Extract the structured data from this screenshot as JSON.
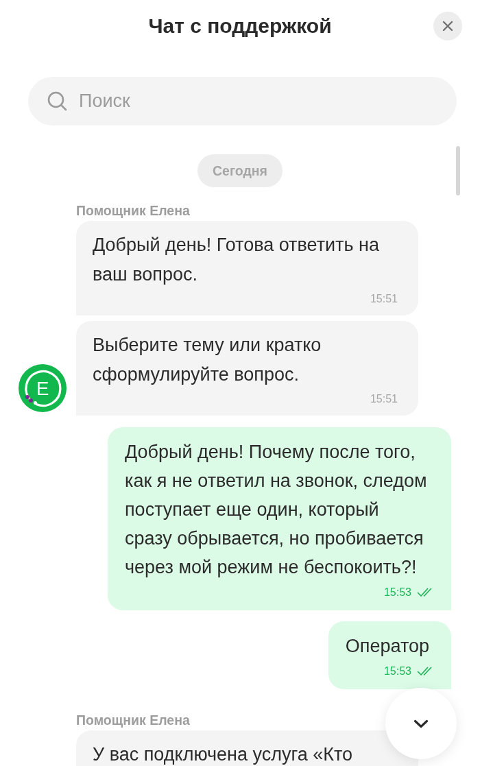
{
  "header": {
    "title": "Чат с поддержкой"
  },
  "search": {
    "placeholder": "Поиск"
  },
  "date_separator": {
    "label": "Сегодня"
  },
  "messages": [
    {
      "kind": "incoming",
      "sender": "Помощник Елена",
      "text": "Добрый день! Готова ответить на ваш вопрос.",
      "time": "15:51"
    },
    {
      "kind": "incoming",
      "text": "Выберите тему или кратко сформулируйте вопрос.",
      "time": "15:51",
      "avatar": {
        "letter": "Е"
      }
    },
    {
      "kind": "outgoing",
      "text": "Добрый день! Почему после того, как я не ответил на звонок, следом поступает еще один, который сразу обрывается, но пробивается через мой режим не беспокоить?!",
      "time": "15:53",
      "read": true
    },
    {
      "kind": "outgoing",
      "text": "Оператор",
      "time": "15:53",
      "read": true
    },
    {
      "kind": "incoming",
      "sender": "Помощник Елена",
      "text": "У вас подключена услуга «Кто"
    }
  ]
}
